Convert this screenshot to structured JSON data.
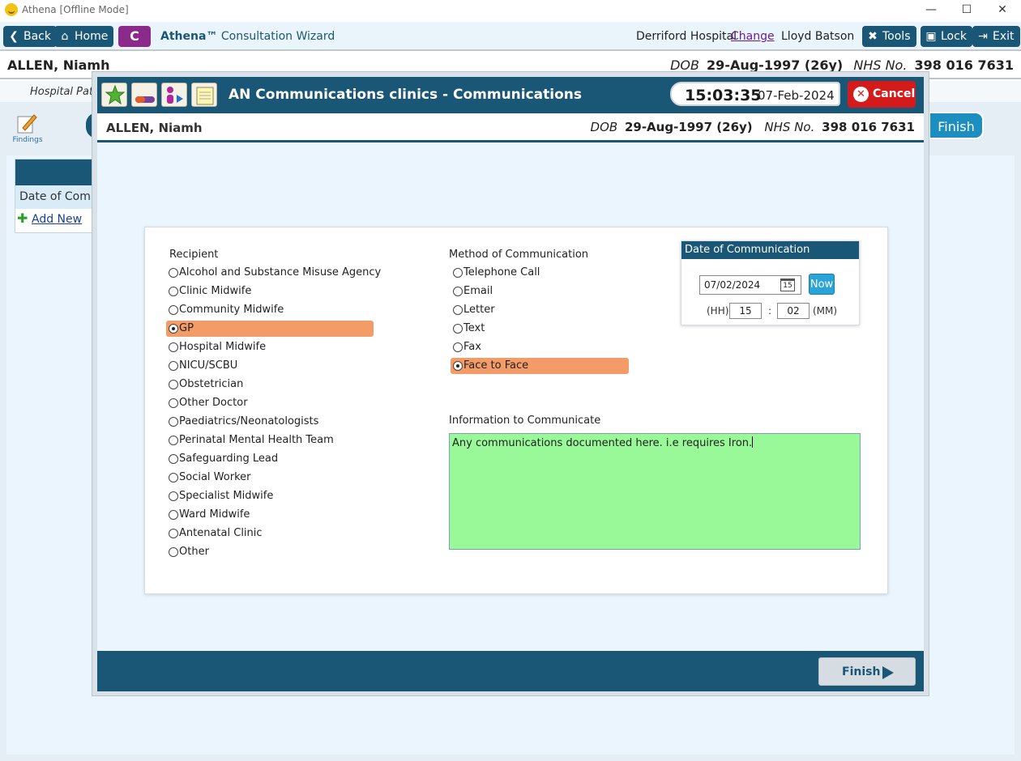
{
  "window": {
    "title": "Athena [Offline Mode]"
  },
  "nav": {
    "back_label": "Back",
    "home_label": "Home",
    "c_label": "C",
    "brand": "Athena™",
    "wizard_title": "Consultation Wizard",
    "hospital": "Derriford Hospital",
    "change_label": "Change",
    "user": "Lloyd Batson",
    "tools_label": "Tools",
    "lock_label": "Lock",
    "exit_label": "Exit"
  },
  "patient": {
    "name": "ALLEN, Niamh",
    "dob_label": "DOB",
    "dob": "29-Aug-1997 (26y)",
    "nhs_label": "NHS No.",
    "nhs": "398 016 7631"
  },
  "background": {
    "subbar_text": "Hospital Patie",
    "findings_label": "Findings",
    "finish_label": "Finish",
    "table_header": "Date of Commu",
    "add_new_label": "Add New"
  },
  "modal": {
    "title": "AN Communications clinics - Communications",
    "time": "15:03:35",
    "date": "07-Feb-2024",
    "cancel_label": "Cancel",
    "finish_label": "Finish"
  },
  "form": {
    "recipient_label": "Recipient",
    "recipients": [
      {
        "label": "Alcohol and Substance Misuse Agency",
        "selected": false
      },
      {
        "label": "Clinic Midwife",
        "selected": false
      },
      {
        "label": "Community Midwife",
        "selected": false
      },
      {
        "label": "GP",
        "selected": true
      },
      {
        "label": "Hospital Midwife",
        "selected": false
      },
      {
        "label": "NICU/SCBU",
        "selected": false
      },
      {
        "label": "Obstetrician",
        "selected": false
      },
      {
        "label": "Other Doctor",
        "selected": false
      },
      {
        "label": "Paediatrics/Neonatologists",
        "selected": false
      },
      {
        "label": "Perinatal Mental Health Team",
        "selected": false
      },
      {
        "label": "Safeguarding Lead",
        "selected": false
      },
      {
        "label": "Social Worker",
        "selected": false
      },
      {
        "label": "Specialist Midwife",
        "selected": false
      },
      {
        "label": "Ward Midwife",
        "selected": false
      },
      {
        "label": "Antenatal Clinic",
        "selected": false
      },
      {
        "label": "Other",
        "selected": false
      }
    ],
    "method_label": "Method of Communication",
    "methods": [
      {
        "label": "Telephone Call",
        "selected": false
      },
      {
        "label": "Email",
        "selected": false
      },
      {
        "label": "Letter",
        "selected": false
      },
      {
        "label": "Text",
        "selected": false
      },
      {
        "label": "Fax",
        "selected": false
      },
      {
        "label": "Face to Face",
        "selected": true
      }
    ],
    "date_box": {
      "title": "Date of Communication",
      "date_value": "07/02/2024",
      "calendar_day": "15",
      "now_label": "Now",
      "hh_label": "(HH)",
      "hh_value": "15",
      "separator": ":",
      "mm_value": "02",
      "mm_label": "(MM)"
    },
    "info_label": "Information to Communicate",
    "info_value": "Any communications documented here. i.e requires Iron."
  },
  "colors": {
    "primary": "#1a5675",
    "selected": "#f39c68",
    "cancel": "#d31b1b",
    "info_bg": "#99f898",
    "c_button": "#8c2a8c"
  }
}
